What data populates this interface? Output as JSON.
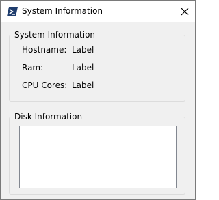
{
  "window": {
    "title": "System Information",
    "app_icon": "powershell-icon",
    "close_icon": "close-icon"
  },
  "system_group": {
    "title": "System Information",
    "hostname_label": "Hostname:",
    "hostname_value": "Label",
    "ram_label": "Ram:",
    "ram_value": "Label",
    "cpu_label": "CPU Cores:",
    "cpu_value": "Label"
  },
  "disk_group": {
    "title": "Disk Information",
    "content": ""
  }
}
